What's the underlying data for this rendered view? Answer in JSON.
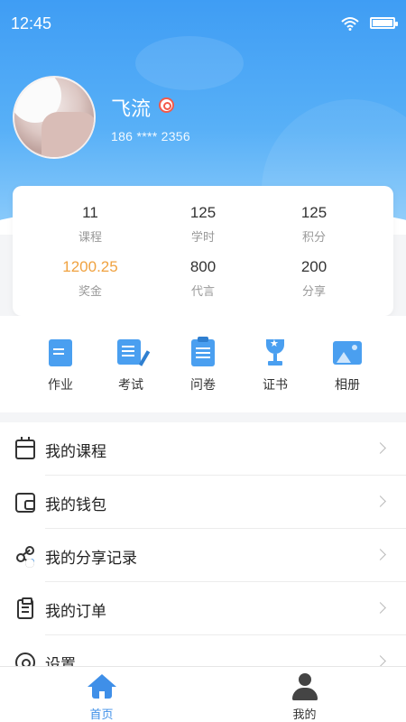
{
  "status_bar": {
    "time": "12:45"
  },
  "profile": {
    "name": "飞流",
    "phone": "186 **** 2356"
  },
  "stats": [
    {
      "value": "11",
      "label": "课程"
    },
    {
      "value": "125",
      "label": "学时"
    },
    {
      "value": "125",
      "label": "积分"
    },
    {
      "value": "1200.25",
      "label": "奖金"
    },
    {
      "value": "800",
      "label": "代言"
    },
    {
      "value": "200",
      "label": "分享"
    }
  ],
  "quick_actions": [
    {
      "label": "作业",
      "icon": "homework-icon"
    },
    {
      "label": "考试",
      "icon": "exam-icon"
    },
    {
      "label": "问卷",
      "icon": "survey-icon"
    },
    {
      "label": "证书",
      "icon": "trophy-icon"
    },
    {
      "label": "相册",
      "icon": "album-icon"
    }
  ],
  "menu": [
    {
      "label": "我的课程",
      "icon": "calendar-icon"
    },
    {
      "label": "我的钱包",
      "icon": "wallet-icon"
    },
    {
      "label": "我的分享记录",
      "icon": "share-icon"
    },
    {
      "label": "我的订单",
      "icon": "clipboard-icon"
    },
    {
      "label": "设置",
      "icon": "gear-icon"
    }
  ],
  "tabs": [
    {
      "label": "首页",
      "icon": "home-icon",
      "active": true
    },
    {
      "label": "我的",
      "icon": "user-icon",
      "active": false
    }
  ],
  "colors": {
    "primary": "#3f8fe8",
    "highlight_value": "#f0a240",
    "header_gradient_top": "#3f9df4",
    "header_gradient_bottom": "#8fcdfb"
  }
}
